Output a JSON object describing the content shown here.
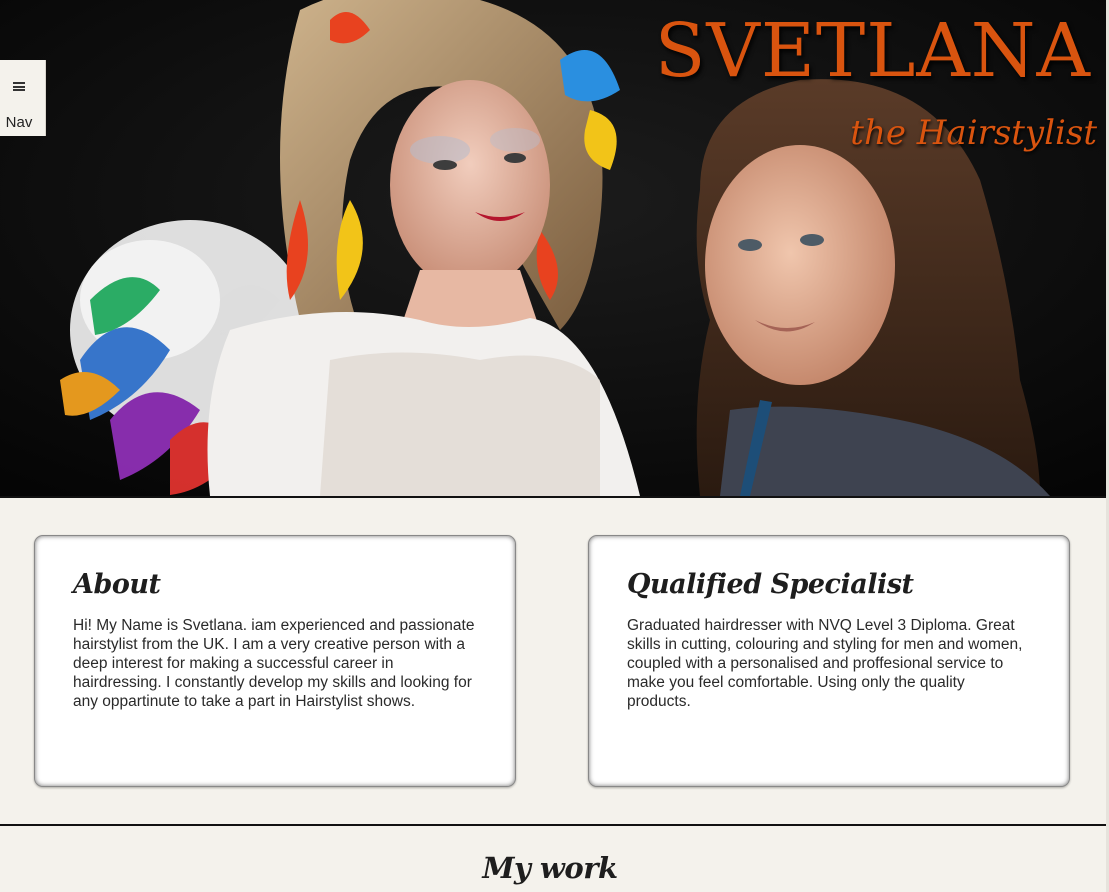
{
  "hero": {
    "title": "SVETLANA",
    "subtitle": "the Hairstylist",
    "image_icon": "portrait-photo"
  },
  "nav": {
    "label": "Nav",
    "icon": "hamburger-icon"
  },
  "about": {
    "heading": "About",
    "body": "Hi! My Name is Svetlana. iam experienced and passionate hairstylist from the UK. I am a very creative person with a deep interest for making a successful career in hairdressing. I constantly develop my skills and looking for any oppartinute to take a part in Hairstylist shows."
  },
  "qualified": {
    "heading": "Qualified Specialist",
    "body": "Graduated hairdresser with NVQ Level 3 Diploma. Great skills in cutting, colouring and styling for men and women, coupled with a personalised and proffesional service to make you feel comfortable. Using only the quality products."
  },
  "work": {
    "heading": "My work"
  },
  "colors": {
    "accent": "#d9540f",
    "background": "#f4f2ec",
    "text": "#2a2a2a"
  }
}
